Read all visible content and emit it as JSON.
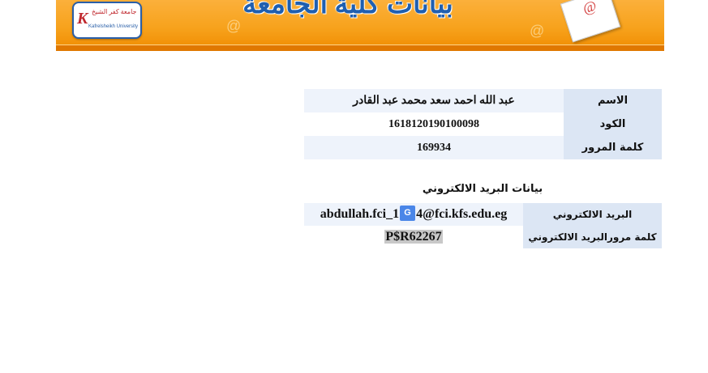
{
  "banner": {
    "title": "بيانات كلية الجامعة",
    "logo_arabic": "جامعة كفر الشيخ",
    "logo_english": "Kafrelsheikh University",
    "logo_letter": "K",
    "at_symbol": "@",
    "envelope_mark": "@"
  },
  "personal": {
    "name_label": "الاسم",
    "name_value": "عبد الله احمد سعد محمد عبد القادر",
    "code_label": "الكود",
    "code_value": "1618120190100098",
    "password_label": "كلمة المرور",
    "password_value": "169934"
  },
  "email_section": {
    "heading": "بيانات البريد الالكتروني",
    "email_label": "البريد الالكتروني",
    "email_prefix": "abdullah.fci_1",
    "email_suffix": "4@fci.kfs.edu.eg",
    "translate_icon": "G",
    "email_password_label": "كلمة مرورالبريد الالكتروني",
    "email_password_value": "P$R62267"
  }
}
